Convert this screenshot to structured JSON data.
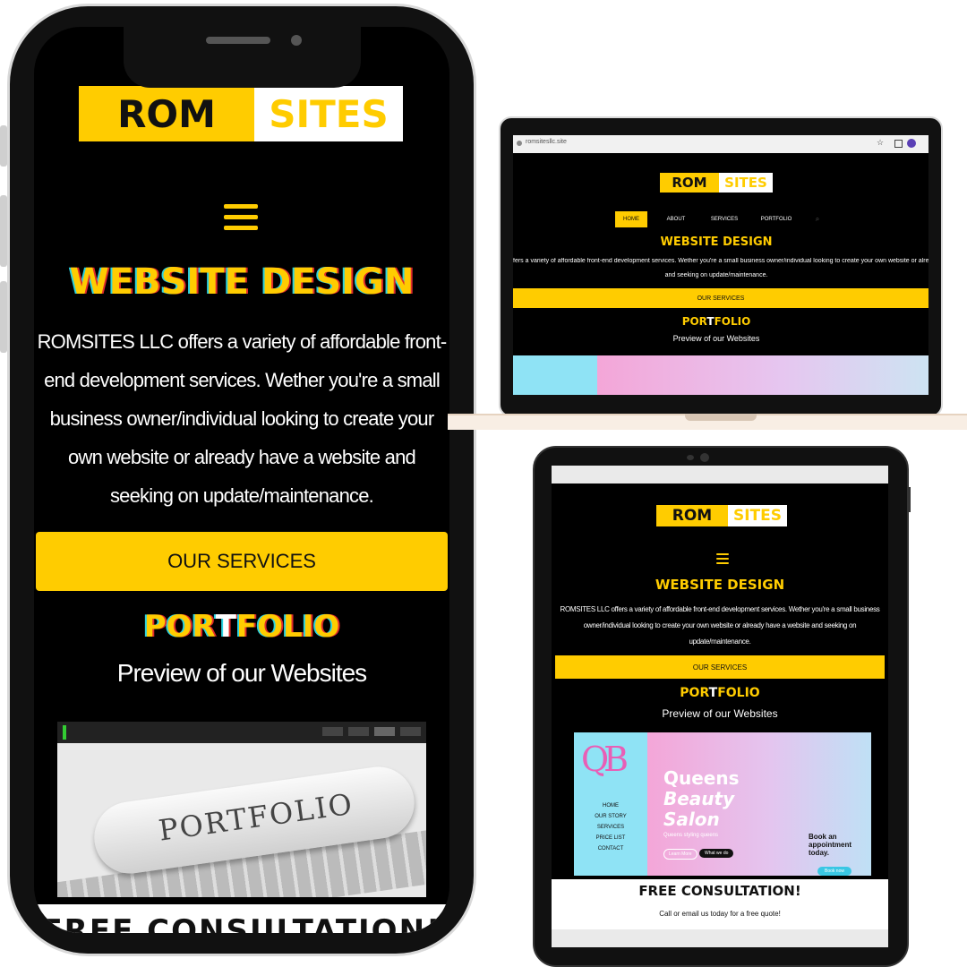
{
  "brand": {
    "logo_left": "ROM",
    "logo_right": "SITES"
  },
  "hero": {
    "title": "WEBSITE DESIGN",
    "text": "ROMSITES LLC offers a variety of affordable front-end development services. Wether you're a small business owner/individual looking to create your own website or already have a website and seeking on update/maintenance.",
    "laptop_line1": "fers a variety of affordable front-end development services. Wether you're a small business owner/individual looking to create your own website or already h",
    "laptop_line2": "and seeking on update/maintenance.",
    "cta": "OUR SERVICES"
  },
  "portfolio": {
    "title_a": "POR",
    "title_b": "T",
    "title_c": "F",
    "title_d": "OLIO",
    "subtitle": "Preview of our Websites",
    "phone_image_word": "PORTFOLIO"
  },
  "phone": {
    "footer_text": "FREE CONSULTATION!"
  },
  "laptop": {
    "url": "romsitesllc.site",
    "nav": [
      "HOME",
      "ABOUT",
      "SERVICES",
      "PORTFOLIO"
    ]
  },
  "tablet": {
    "salon_logo": "QB",
    "salon_title_1": "Queens",
    "salon_title_2": "Beauty",
    "salon_title_3": "Salon",
    "salon_tagline": "Queens styling queens",
    "salon_btn_1": "Learn More",
    "salon_btn_2": "What we do",
    "salon_nav": [
      "HOME",
      "OUR STORY",
      "SERVICES",
      "PRICE LIST",
      "CONTACT"
    ],
    "salon_appt_1": "Book an",
    "salon_appt_2": "appointment",
    "salon_appt_3": "today.",
    "salon_appt_btn": "Book now",
    "consult_title": "FREE CONSULTATION!",
    "consult_text": "Call or email us today for a free quote!"
  },
  "colors": {
    "accent": "#ffcc00",
    "background": "#000000",
    "frame": "#111111"
  }
}
